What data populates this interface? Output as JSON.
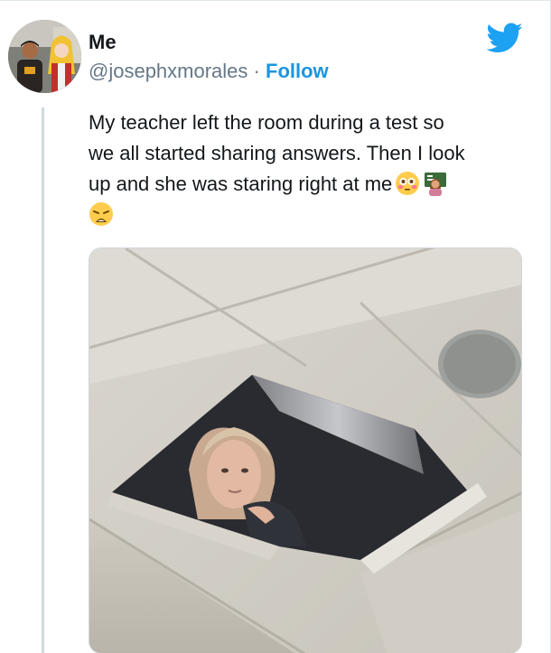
{
  "tweet": {
    "author_name": "Me",
    "handle": "@josephxmorales",
    "separator": "·",
    "follow_label": "Follow",
    "text_lines": [
      "My teacher left the room during a test so",
      "we all started sharing answers. Then I look",
      "up and she was staring right at me"
    ],
    "emojis_line3": [
      "flushed-face-emoji",
      "woman-teacher-emoji"
    ],
    "emojis_line4": [
      "weary-face-emoji"
    ]
  },
  "media": {
    "description_icon": "photo-ceiling-teacher"
  },
  "colors": {
    "link_blue": "#1b95e0",
    "text_dark": "#14171a",
    "text_muted": "#657786",
    "twitter_blue": "#1da1f2"
  }
}
